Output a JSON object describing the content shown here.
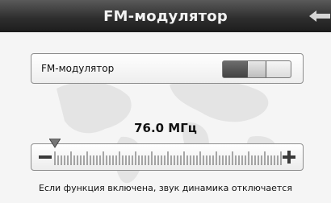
{
  "header": {
    "title": "FM-модулятор",
    "back_icon": "back-arrow-icon"
  },
  "fm_setting": {
    "label": "FM-модулятор",
    "enabled": true
  },
  "frequency": {
    "display": "76.0 МГц"
  },
  "slider": {
    "minus_label": "−",
    "plus_label": "+",
    "level": 0.0,
    "minus_icon": "minus-icon",
    "plus_icon": "plus-icon"
  },
  "hint": "Если функция включена, звук динамика отключается"
}
